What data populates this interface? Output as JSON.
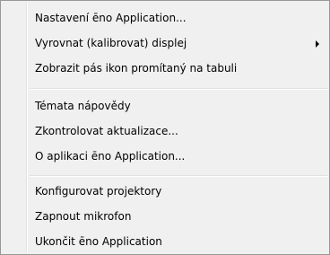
{
  "menu": {
    "items": [
      {
        "label": "Nastavení ēno Application..."
      },
      {
        "label": "Vyrovnat (kalibrovat) displej",
        "has_submenu": true
      },
      {
        "label": "Zobrazit pás ikon promítaný na tabuli"
      },
      {
        "label": "Témata nápovědy"
      },
      {
        "label": "Zkontrolovat aktualizace..."
      },
      {
        "label": "O aplikaci ēno Application..."
      },
      {
        "label": "Konfigurovat projektory"
      },
      {
        "label": "Zapnout mikrofon"
      },
      {
        "label": "Ukončit ēno Application"
      }
    ]
  }
}
